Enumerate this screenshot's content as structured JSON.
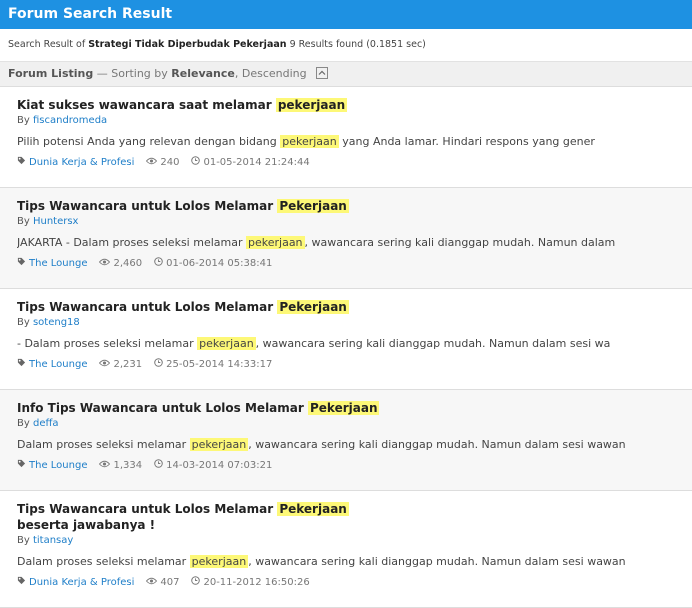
{
  "header": {
    "title": "Forum Search Result"
  },
  "summary": {
    "prefix": "Search Result of",
    "query": "Strategi Tidak Diperbudak Pekerjaan",
    "count": "9 Results found (0.1851 sec)"
  },
  "listing": {
    "label": "Forum Listing",
    "sep": "— Sorting by",
    "sort_field": "Relevance",
    "sort_dir": ", Descending"
  },
  "results": [
    {
      "title_pre": "Kiat sukses wawancara saat melamar ",
      "title_hl": "pekerjaan",
      "title_post": "",
      "by_label": "By ",
      "author": "fiscandromeda",
      "snippet_pre": "Pilih potensi Anda yang relevan dengan bidang ",
      "snippet_hl": "pekerjaan",
      "snippet_post": " yang Anda lamar. Hindari respons yang gener",
      "category": "Dunia Kerja & Profesi",
      "views": "240",
      "date": "01-05-2014 21:24:44"
    },
    {
      "title_pre": "Tips Wawancara untuk Lolos Melamar ",
      "title_hl": "Pekerjaan",
      "title_post": "",
      "by_label": "By ",
      "author": "Huntersx",
      "snippet_pre": "JAKARTA - Dalam proses seleksi melamar ",
      "snippet_hl": "pekerjaan",
      "snippet_post": ", wawancara sering kali dianggap mudah. Namun dalam",
      "category": "The Lounge",
      "views": "2,460",
      "date": "01-06-2014 05:38:41"
    },
    {
      "title_pre": "Tips Wawancara untuk Lolos Melamar ",
      "title_hl": "Pekerjaan",
      "title_post": "",
      "by_label": "By ",
      "author": "soteng18",
      "snippet_pre": "- Dalam proses seleksi melamar ",
      "snippet_hl": "pekerjaan",
      "snippet_post": ", wawancara sering kali dianggap mudah. Namun dalam sesi wa",
      "category": "The Lounge",
      "views": "2,231",
      "date": "25-05-2014 14:33:17"
    },
    {
      "title_pre": "Info Tips Wawancara untuk Lolos Melamar ",
      "title_hl": "Pekerjaan",
      "title_post": "",
      "by_label": "By ",
      "author": "deffa",
      "snippet_pre": "Dalam proses seleksi melamar ",
      "snippet_hl": "pekerjaan",
      "snippet_post": ", wawancara sering kali dianggap mudah. Namun dalam sesi wawan",
      "category": "The Lounge",
      "views": "1,334",
      "date": "14-03-2014 07:03:21"
    },
    {
      "title_pre": "Tips Wawancara untuk Lolos Melamar ",
      "title_hl": "Pekerjaan",
      "title_post": " beserta jawabanya !",
      "by_label": "By ",
      "author": "titansay",
      "snippet_pre": "Dalam proses seleksi melamar ",
      "snippet_hl": "pekerjaan",
      "snippet_post": ", wawancara sering kali dianggap mudah. Namun dalam sesi wawan",
      "category": "Dunia Kerja & Profesi",
      "views": "407",
      "date": "20-11-2012 16:50:26"
    }
  ],
  "colors": {
    "header": "#1e91e2",
    "highlight": "#fdf877",
    "link": "#1e7ec8"
  },
  "icons": {
    "tag": "tag-icon",
    "views": "eye-icon",
    "clock": "clock-icon",
    "sort": "sort-toggle-icon"
  }
}
